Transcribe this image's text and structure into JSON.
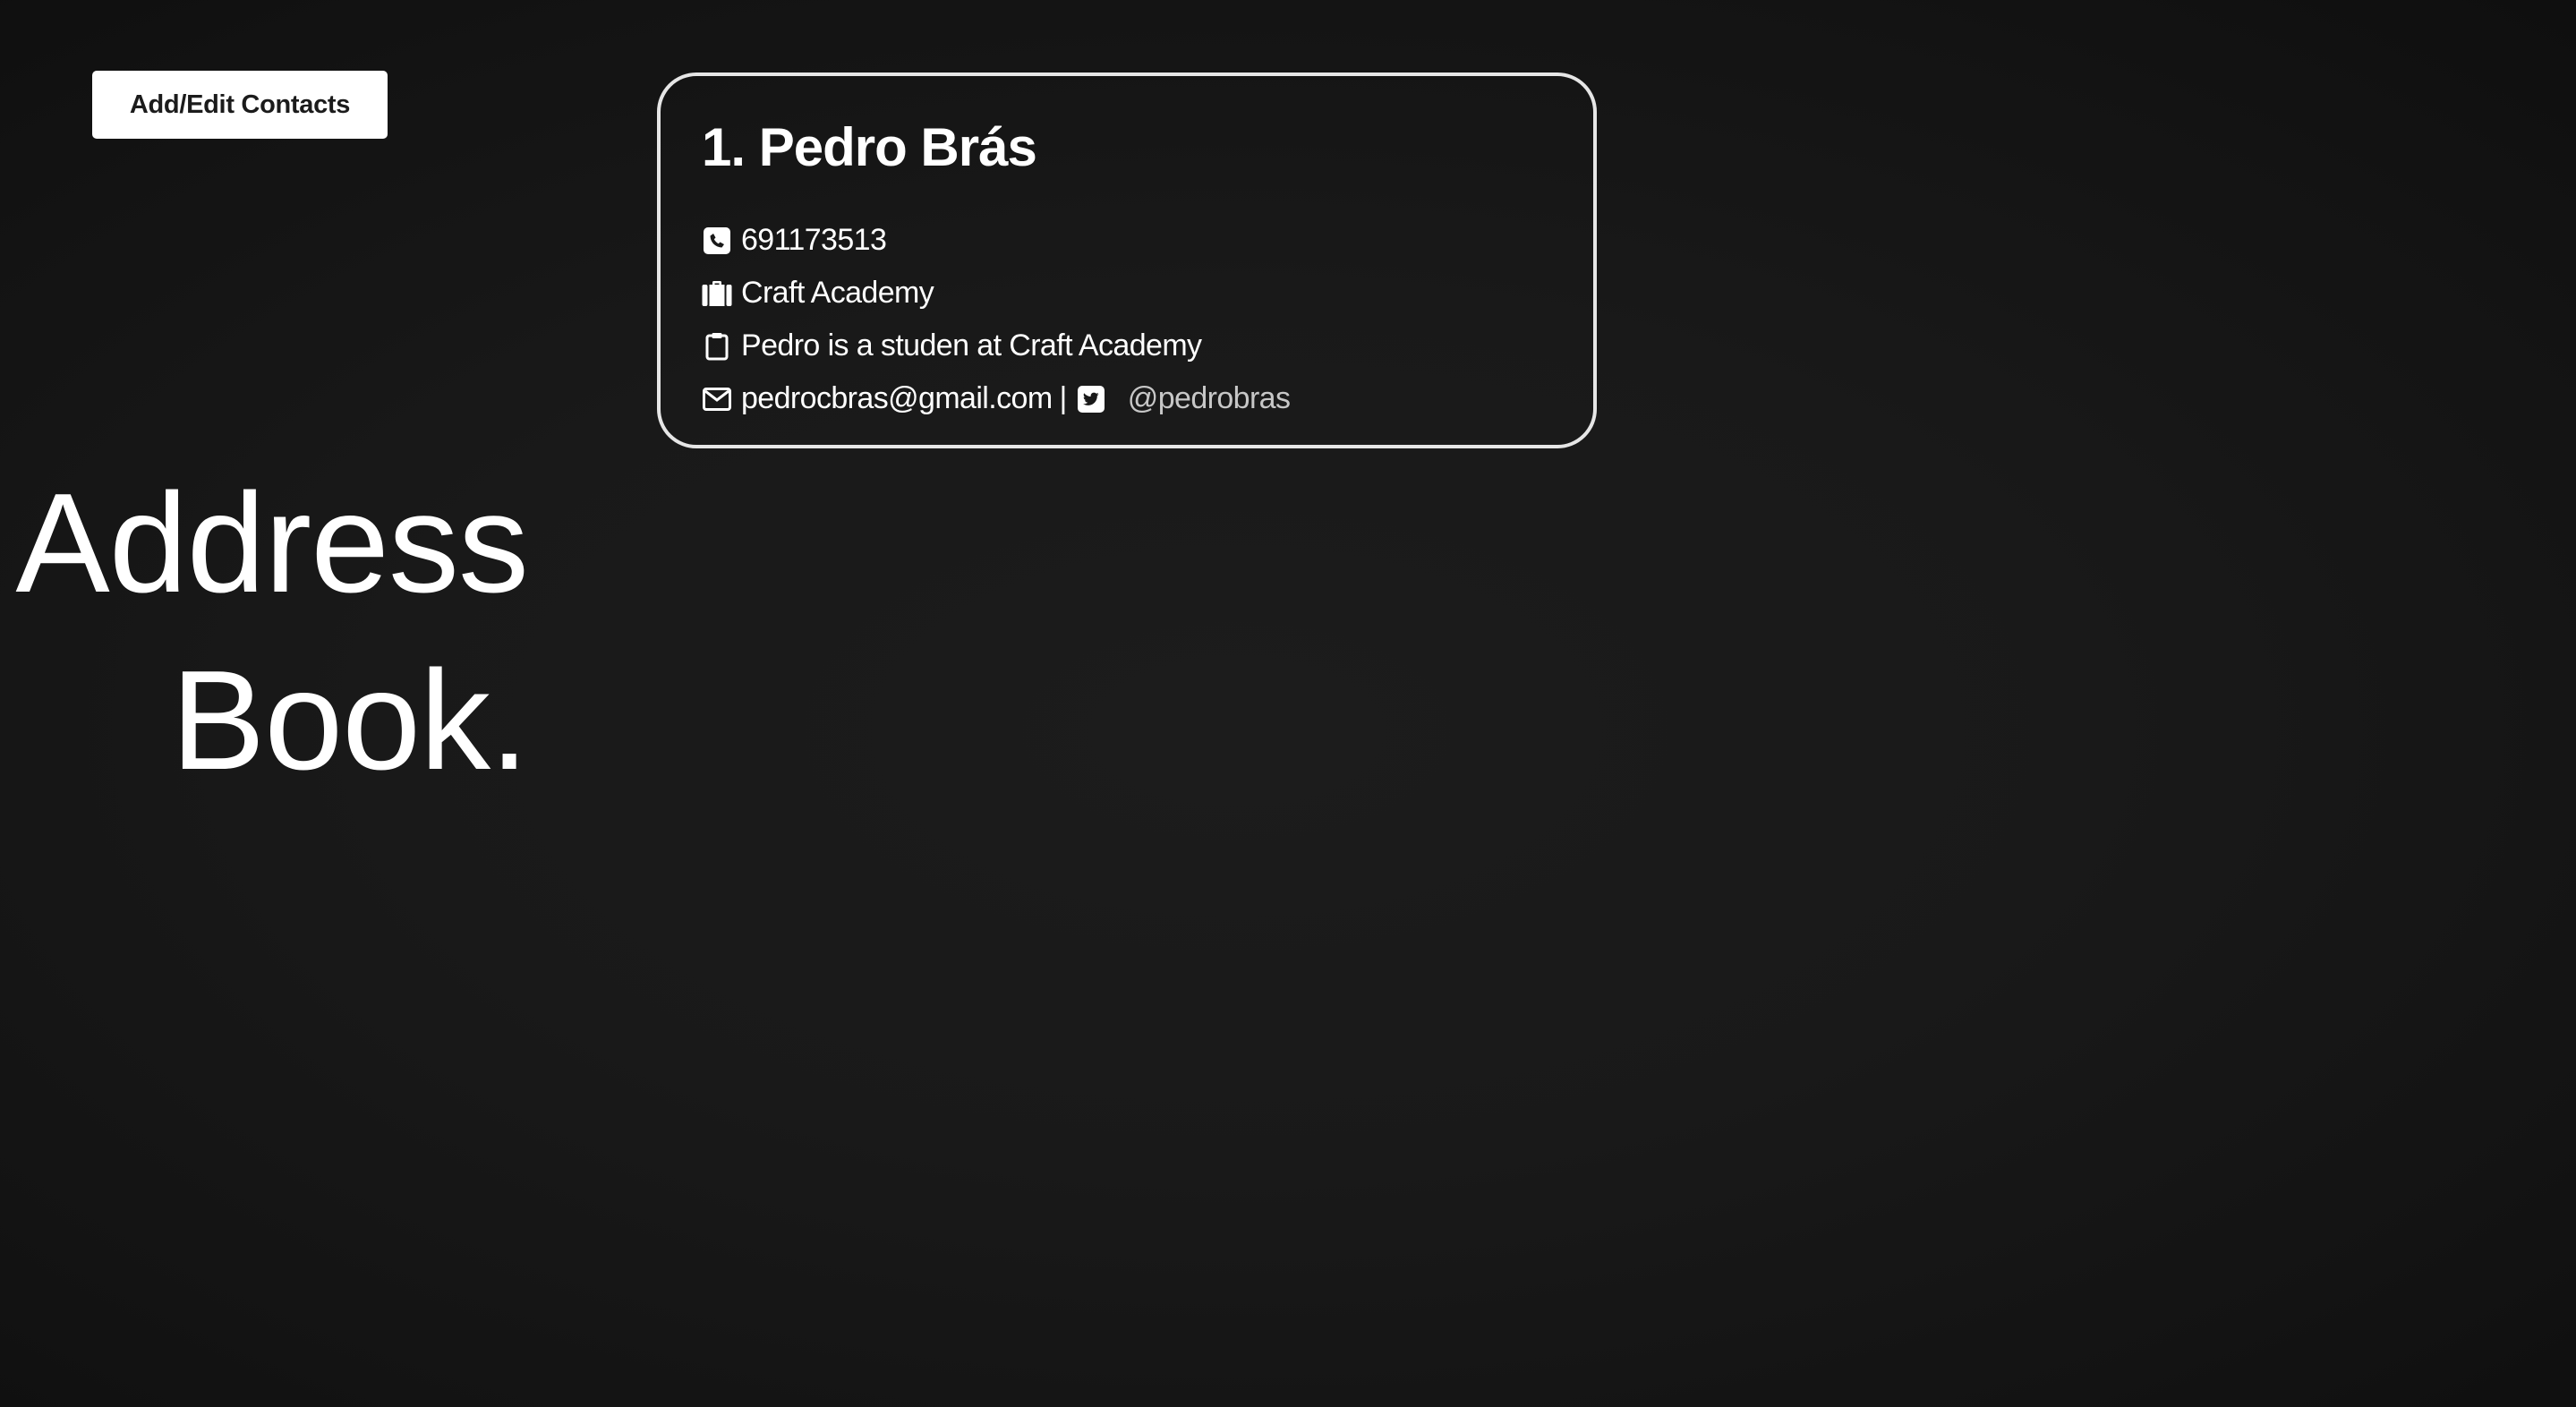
{
  "toolbar": {
    "add_edit_label": "Add/Edit Contacts"
  },
  "title": {
    "line1": "Address",
    "line2": "Book."
  },
  "contact": {
    "heading": "1. Pedro Brás",
    "phone": "691173513",
    "company": "Craft Academy",
    "notes": "Pedro is a studen at Craft Academy",
    "email": "pedrocbras@gmail.com",
    "separator": "|",
    "twitter": "@pedrobras"
  },
  "icons": {
    "phone": "phone-square-icon",
    "company": "briefcase-icon",
    "notes": "clipboard-icon",
    "email": "envelope-icon",
    "twitter": "twitter-square-icon"
  },
  "colors": {
    "background": "#191919",
    "text": "#ffffff",
    "card_border": "#e6e6e6",
    "button_bg": "#ffffff",
    "button_text": "#1b1b1b",
    "muted_link": "#c7c7c7"
  }
}
